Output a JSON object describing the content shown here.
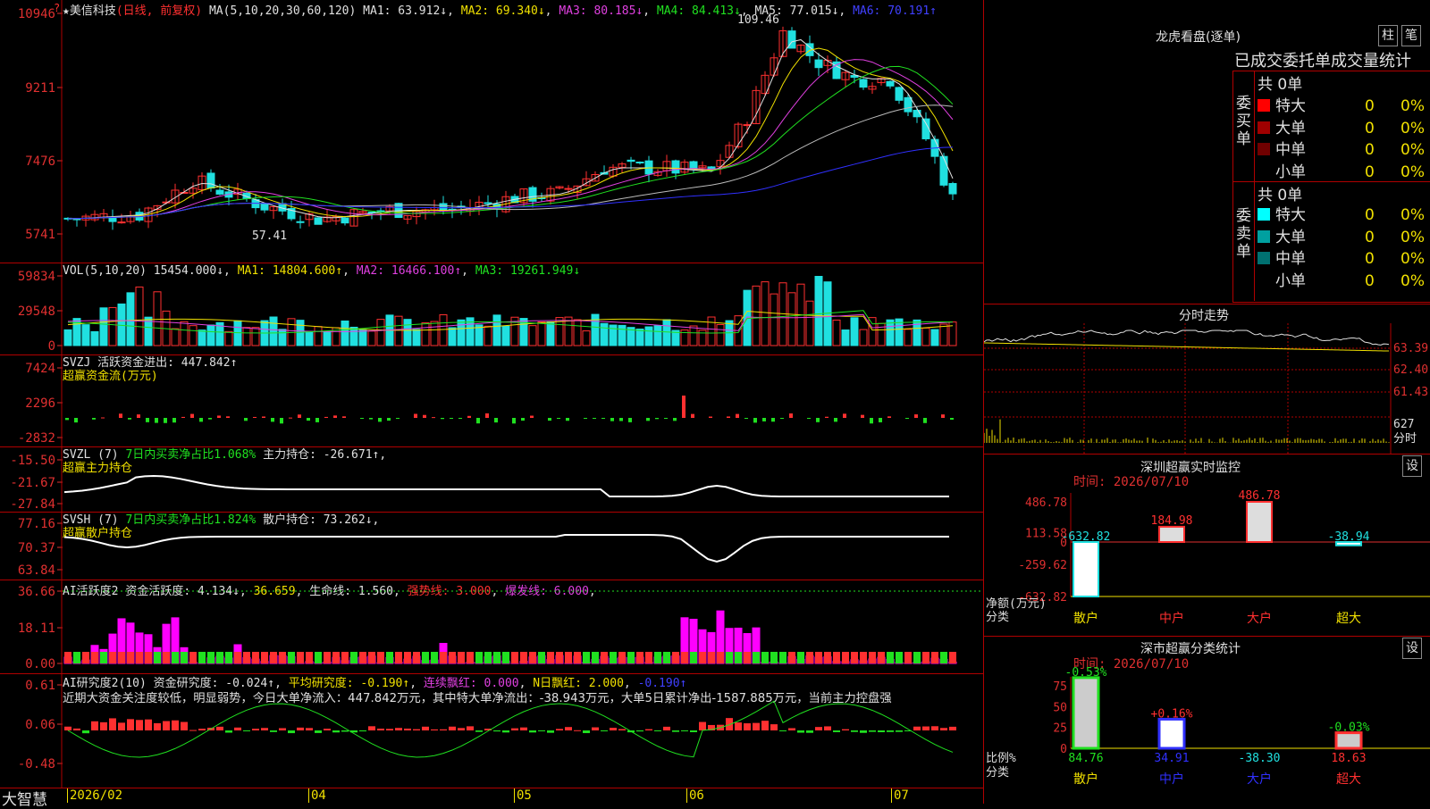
{
  "stock": {
    "name": "★美信科技",
    "mode": "(日线, 前复权)",
    "ma_label": "MA(5,10,20,30,60,120)",
    "ma1": "MA1: 63.912↓",
    "ma2": "MA2: 69.340↓",
    "ma3": "MA3: 80.185↓",
    "ma4": "MA4: 84.413↓",
    "ma5": "MA5: 77.015↓",
    "ma6": "MA6: 70.191↑",
    "high_mark": "109.46",
    "low_mark": "57.41",
    "q_mark": "?"
  },
  "price_axis": [
    "10946",
    "9211",
    "7476",
    "5741"
  ],
  "vol": {
    "label": "VOL(5,10,20)",
    "v": "15454.000↓",
    "ma1": "MA1: 14804.600↑",
    "ma2": "MA2: 16466.100↑",
    "ma3": "MA3: 19261.949↓",
    "axis": [
      "59834",
      "29548",
      "0"
    ]
  },
  "svzj": {
    "label": "SVZJ",
    "text": "活跃资金进出: 447.842↑",
    "sub": "超赢资金流(万元)",
    "axis": [
      "7424",
      "2296",
      "-2832"
    ]
  },
  "svzl": {
    "label": "SVZL (7)",
    "ratio": "7日内买卖净占比1.068%",
    "hold": "主力持仓: -26.671↑,",
    "sub": "超赢主力持仓",
    "axis": [
      "-15.50",
      "-21.67",
      "-27.84"
    ]
  },
  "svsh": {
    "label": "SVSH (7)",
    "ratio": "7日内买卖净占比1.824%",
    "hold": "散户持仓: 73.262↓,",
    "sub": "超赢散户持仓",
    "axis": [
      "77.16",
      "70.37",
      "63.84"
    ]
  },
  "ai1": {
    "label": "AI活跃度2",
    "a": "资金活跃度: 4.134↓",
    "b": "36.659",
    "c": "生命线: 1.560",
    "d": "强势线: 3.000",
    "e": "爆发线: 6.000",
    "axis": [
      "36.66",
      "18.11",
      "0.00"
    ]
  },
  "ai2": {
    "label": "AI研究度2(10)",
    "a": "资金研究度: -0.024↑",
    "b": "平均研究度: -0.190↑",
    "c": "连续飘红: 0.000",
    "d": "N日飘红: 2.000",
    "e": "-0.190↑",
    "note": "近期大资金关注度较低，明显弱势，今日大单净流入：447.842万元，其中特大单净流出：-38.943万元，大单5日累计净出-1587.885万元，当前主力控盘强",
    "axis": [
      "0.61",
      "0.06",
      "-0.48"
    ]
  },
  "xaxis": [
    "2026/02",
    "04",
    "05",
    "06",
    "07"
  ],
  "brand": "大智慧",
  "lhb": {
    "title": "龙虎看盘(逐单)",
    "btn1": "柱",
    "btn2": "笔",
    "tabs": "已成交委托单成交量统计",
    "buy_title": "共 0单",
    "buy_side": "委买单",
    "sell_title": "共 0单",
    "sell_side": "委卖单",
    "buy": [
      {
        "label": "特大",
        "n": "0",
        "p": "0%",
        "color": "#ff0000"
      },
      {
        "label": "大单",
        "n": "0",
        "p": "0%",
        "color": "#a00000"
      },
      {
        "label": "中单",
        "n": "0",
        "p": "0%",
        "color": "#700000"
      },
      {
        "label": "小单",
        "n": "0",
        "p": "0%",
        "color": "#000000"
      }
    ],
    "sell": [
      {
        "label": "特大",
        "n": "0",
        "p": "0%",
        "color": "#00ffff"
      },
      {
        "label": "大单",
        "n": "0",
        "p": "0%",
        "color": "#00a0a0"
      },
      {
        "label": "中单",
        "n": "0",
        "p": "0%",
        "color": "#007070"
      },
      {
        "label": "小单",
        "n": "0",
        "p": "0%",
        "color": "#000000"
      }
    ]
  },
  "fenshi": {
    "title": "分时走势",
    "axis": [
      "63.39",
      "62.40",
      "61.43"
    ],
    "vol_axis": [
      "627",
      "分时"
    ]
  },
  "sz_monitor": {
    "title": "深圳超赢实时监控",
    "btn": "设",
    "time": "时间: 2026/07/10",
    "axis": [
      "486.78",
      "113.58",
      "0",
      "-259.62",
      "-632.82"
    ],
    "ylabel1": "净额(万元)",
    "ylabel2": "分类"
  },
  "sz_class": {
    "title": "深市超赢分类统计",
    "btn": "设",
    "time": "时间: 2026/07/10",
    "axis": [
      "75",
      "50",
      "25",
      "0"
    ],
    "ylabel1": "比例%",
    "ylabel2": "分类"
  },
  "chart_data": [
    {
      "type": "bar",
      "title": "深圳超赢实时监控",
      "categories": [
        "散户",
        "中户",
        "大户",
        "超大"
      ],
      "values": [
        -632.82,
        184.98,
        486.78,
        -38.94
      ],
      "ylabel": "净额(万元)",
      "ylim": [
        -632.82,
        486.78
      ]
    },
    {
      "type": "bar",
      "title": "深市超赢分类统计",
      "categories": [
        "散户",
        "中户",
        "大户",
        "超大"
      ],
      "values": [
        84.76,
        34.91,
        -38.3,
        18.63
      ],
      "annotations": [
        "-0.53%",
        "+0.16%",
        "",
        "-0.03%"
      ],
      "ylabel": "比例%",
      "ylim": [
        0,
        75
      ]
    }
  ],
  "colors": {
    "up": "#ff3030",
    "down": "#20e0e0",
    "grid": "#b00000"
  }
}
